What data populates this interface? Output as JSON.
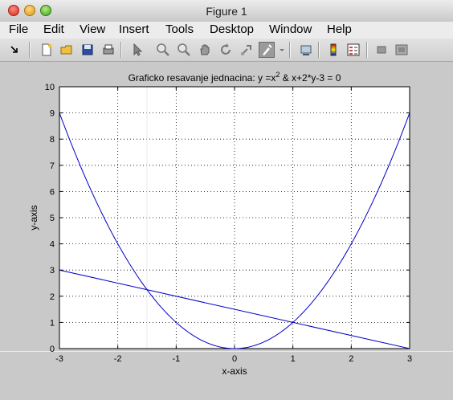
{
  "window": {
    "title": "Figure 1"
  },
  "menu": [
    "File",
    "Edit",
    "View",
    "Insert",
    "Tools",
    "Desktop",
    "Window",
    "Help"
  ],
  "toolbar_icons": [
    "dock-arrow-icon",
    "new-figure-icon",
    "open-file-icon",
    "save-icon",
    "print-icon",
    "edit-plot-arrow-icon",
    "zoom-in-icon",
    "zoom-out-icon",
    "pan-hand-icon",
    "rotate-3d-icon",
    "data-cursor-icon",
    "brush-icon",
    "brush-dropdown-icon",
    "link-plot-icon",
    "colorbar-icon",
    "legend-icon",
    "hide-plot-tools-icon",
    "show-plot-tools-icon"
  ],
  "chart_data": {
    "type": "line",
    "title_parts": {
      "main": "Graficko resavanje jednacina: y =x",
      "sup": "2",
      "rest": " & x+2*y-3 = 0"
    },
    "xlabel": "x-axis",
    "ylabel": "y-axis",
    "xlim": [
      -3,
      3
    ],
    "ylim": [
      0,
      10
    ],
    "xticks": [
      "-3",
      "-2",
      "-1",
      "0",
      "1",
      "2",
      "3"
    ],
    "yticks": [
      "0",
      "1",
      "2",
      "3",
      "4",
      "5",
      "6",
      "7",
      "8",
      "9",
      "10"
    ],
    "grid": true,
    "series": [
      {
        "color": "#0000c8",
        "x": [
          -3,
          -2.5,
          -2,
          -1.5,
          -1,
          -0.5,
          0,
          0.5,
          1,
          1.5,
          2,
          2.5,
          3
        ],
        "y": [
          9,
          6.25,
          4,
          2.25,
          1,
          0.25,
          0,
          0.25,
          1,
          2.25,
          4,
          6.25,
          9
        ]
      },
      {
        "color": "#0000c8",
        "x": [
          -3,
          3
        ],
        "y": [
          3,
          0
        ]
      }
    ]
  }
}
